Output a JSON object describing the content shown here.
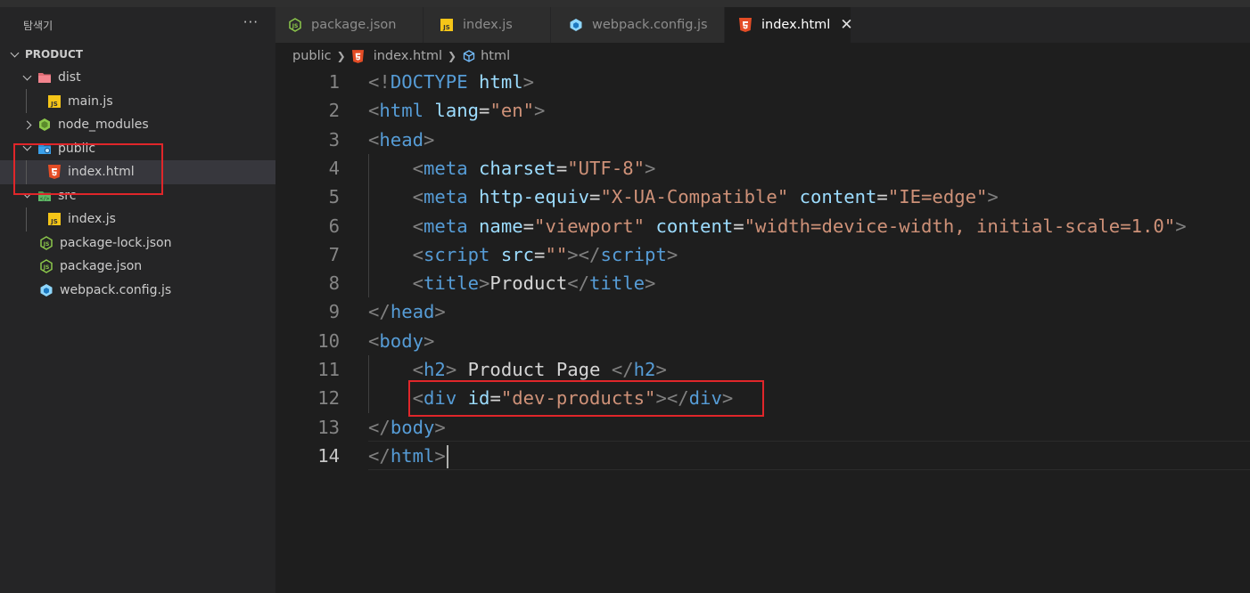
{
  "sidebar": {
    "title": "탐색기",
    "more_label": "···",
    "section": "PRODUCT",
    "items": [
      {
        "label": "dist"
      },
      {
        "label": "main.js"
      },
      {
        "label": "node_modules"
      },
      {
        "label": "public"
      },
      {
        "label": "index.html"
      },
      {
        "label": "src"
      },
      {
        "label": "index.js"
      },
      {
        "label": "package-lock.json"
      },
      {
        "label": "package.json"
      },
      {
        "label": "webpack.config.js"
      }
    ]
  },
  "tabs": [
    {
      "label": "package.json",
      "icon": "json-file-icon"
    },
    {
      "label": "index.js",
      "icon": "js-file-icon"
    },
    {
      "label": "webpack.config.js",
      "icon": "webpack-icon"
    },
    {
      "label": "index.html",
      "icon": "html5-file-icon",
      "active": true,
      "close": "✕"
    }
  ],
  "breadcrumb": {
    "folder": "public",
    "file": "index.html",
    "symbol": "html"
  },
  "editor": {
    "active_line": 14,
    "lines": [
      {
        "num": "1",
        "t": [
          [
            "<!",
            "p"
          ],
          [
            "DOCTYPE",
            "k"
          ],
          [
            " ",
            "x"
          ],
          [
            "html",
            "a"
          ],
          [
            ">",
            "p"
          ]
        ]
      },
      {
        "num": "2",
        "t": [
          [
            "<",
            "p"
          ],
          [
            "html",
            "k"
          ],
          [
            " ",
            "x"
          ],
          [
            "lang",
            "a"
          ],
          [
            "=",
            "e"
          ],
          [
            "\"en\"",
            "s"
          ],
          [
            ">",
            "p"
          ]
        ]
      },
      {
        "num": "3",
        "t": [
          [
            "<",
            "p"
          ],
          [
            "head",
            "k"
          ],
          [
            ">",
            "p"
          ]
        ]
      },
      {
        "num": "4",
        "t": [
          [
            "    ",
            "x"
          ],
          [
            "<",
            "p"
          ],
          [
            "meta",
            "k"
          ],
          [
            " ",
            "x"
          ],
          [
            "charset",
            "a"
          ],
          [
            "=",
            "e"
          ],
          [
            "\"UTF-8\"",
            "s"
          ],
          [
            ">",
            "p"
          ]
        ]
      },
      {
        "num": "5",
        "t": [
          [
            "    ",
            "x"
          ],
          [
            "<",
            "p"
          ],
          [
            "meta",
            "k"
          ],
          [
            " ",
            "x"
          ],
          [
            "http-equiv",
            "a"
          ],
          [
            "=",
            "e"
          ],
          [
            "\"X-UA-Compatible\"",
            "s"
          ],
          [
            " ",
            "x"
          ],
          [
            "content",
            "a"
          ],
          [
            "=",
            "e"
          ],
          [
            "\"IE=edge\"",
            "s"
          ],
          [
            ">",
            "p"
          ]
        ]
      },
      {
        "num": "6",
        "t": [
          [
            "    ",
            "x"
          ],
          [
            "<",
            "p"
          ],
          [
            "meta",
            "k"
          ],
          [
            " ",
            "x"
          ],
          [
            "name",
            "a"
          ],
          [
            "=",
            "e"
          ],
          [
            "\"viewport\"",
            "s"
          ],
          [
            " ",
            "x"
          ],
          [
            "content",
            "a"
          ],
          [
            "=",
            "e"
          ],
          [
            "\"width=device-width, initial-scale=1.0\"",
            "s"
          ],
          [
            ">",
            "p"
          ]
        ]
      },
      {
        "num": "7",
        "t": [
          [
            "    ",
            "x"
          ],
          [
            "<",
            "p"
          ],
          [
            "script",
            "k"
          ],
          [
            " ",
            "x"
          ],
          [
            "src",
            "a"
          ],
          [
            "=",
            "e"
          ],
          [
            "\"\"",
            "s"
          ],
          [
            "></",
            "p"
          ],
          [
            "script",
            "k"
          ],
          [
            ">",
            "p"
          ]
        ]
      },
      {
        "num": "8",
        "t": [
          [
            "    ",
            "x"
          ],
          [
            "<",
            "p"
          ],
          [
            "title",
            "k"
          ],
          [
            ">",
            "p"
          ],
          [
            "Product",
            "x"
          ],
          [
            "</",
            "p"
          ],
          [
            "title",
            "k"
          ],
          [
            ">",
            "p"
          ]
        ]
      },
      {
        "num": "9",
        "t": [
          [
            "</",
            "p"
          ],
          [
            "head",
            "k"
          ],
          [
            ">",
            "p"
          ]
        ]
      },
      {
        "num": "10",
        "t": [
          [
            "<",
            "p"
          ],
          [
            "body",
            "k"
          ],
          [
            ">",
            "p"
          ]
        ]
      },
      {
        "num": "11",
        "t": [
          [
            "    ",
            "x"
          ],
          [
            "<",
            "p"
          ],
          [
            "h2",
            "k"
          ],
          [
            ">",
            "p"
          ],
          [
            " Product Page ",
            "x"
          ],
          [
            "</",
            "p"
          ],
          [
            "h2",
            "k"
          ],
          [
            ">",
            "p"
          ]
        ]
      },
      {
        "num": "12",
        "t": [
          [
            "    ",
            "x"
          ],
          [
            "<",
            "p"
          ],
          [
            "div",
            "k"
          ],
          [
            " ",
            "x"
          ],
          [
            "id",
            "a"
          ],
          [
            "=",
            "e"
          ],
          [
            "\"dev-products\"",
            "s"
          ],
          [
            "></",
            "p"
          ],
          [
            "div",
            "k"
          ],
          [
            ">",
            "p"
          ]
        ]
      },
      {
        "num": "13",
        "t": [
          [
            "</",
            "p"
          ],
          [
            "body",
            "k"
          ],
          [
            ">",
            "p"
          ]
        ]
      },
      {
        "num": "14",
        "t": [
          [
            "</",
            "p"
          ],
          [
            "html",
            "k"
          ],
          [
            ">",
            "p"
          ]
        ]
      }
    ]
  },
  "colors": {
    "highlight": "#e0262a",
    "tag": "#569cd6",
    "attribute": "#9cdcfe",
    "string": "#ce9178"
  }
}
